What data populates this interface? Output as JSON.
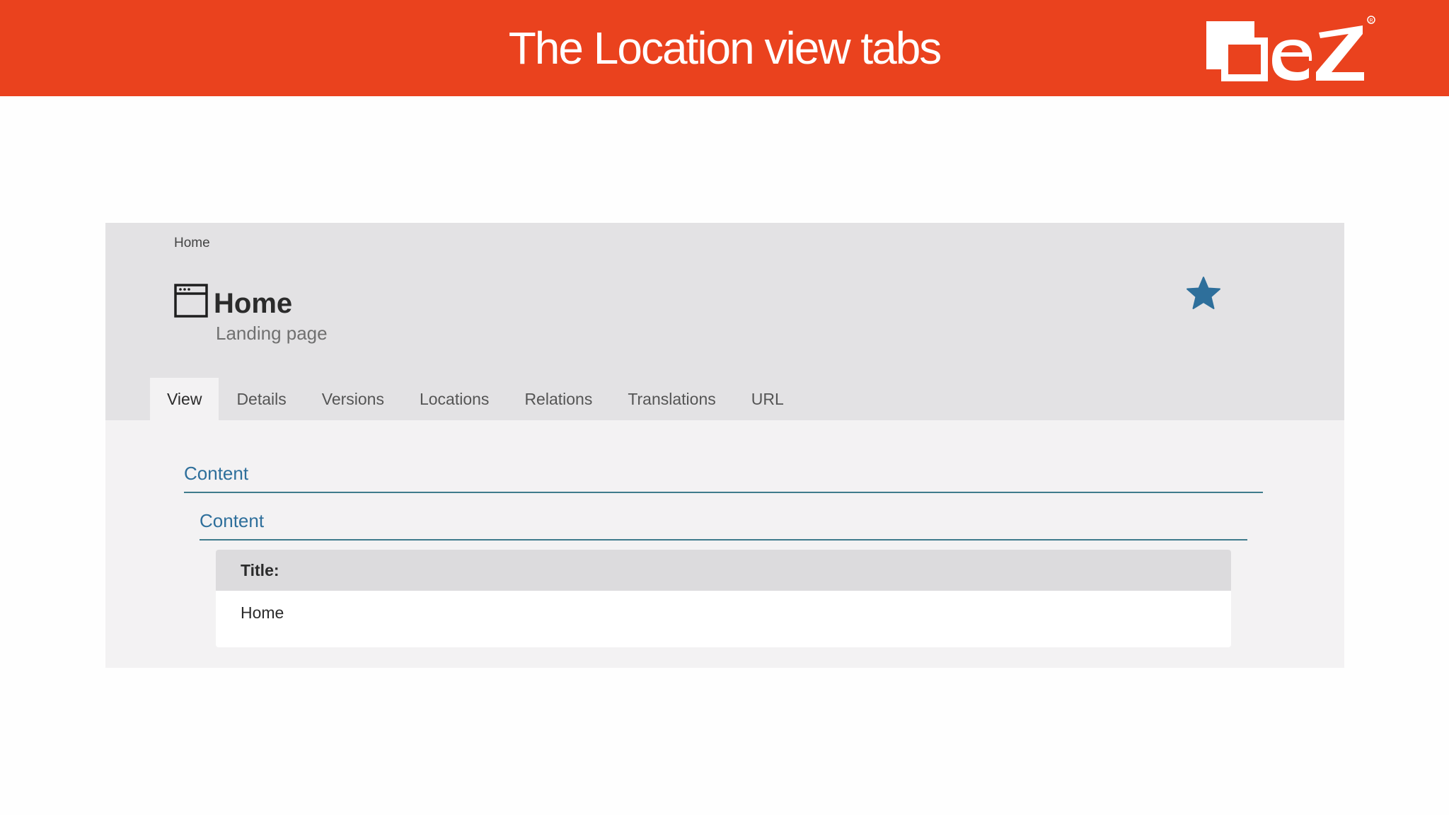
{
  "banner": {
    "title": "The Location view tabs",
    "logo_text": "eZ",
    "color": "#ea421e"
  },
  "breadcrumb": "Home",
  "content": {
    "title": "Home",
    "content_type": "Landing page",
    "icon": "landing-page-icon",
    "bookmark_icon": "star-icon",
    "bookmark_color": "#2e6f9b"
  },
  "tabs": [
    {
      "label": "View",
      "active": true
    },
    {
      "label": "Details",
      "active": false
    },
    {
      "label": "Versions",
      "active": false
    },
    {
      "label": "Locations",
      "active": false
    },
    {
      "label": "Relations",
      "active": false
    },
    {
      "label": "Translations",
      "active": false
    },
    {
      "label": "URL",
      "active": false
    }
  ],
  "view": {
    "section_label": "Content",
    "subsection_label": "Content",
    "fields": [
      {
        "label": "Title:",
        "value": "Home"
      }
    ]
  }
}
